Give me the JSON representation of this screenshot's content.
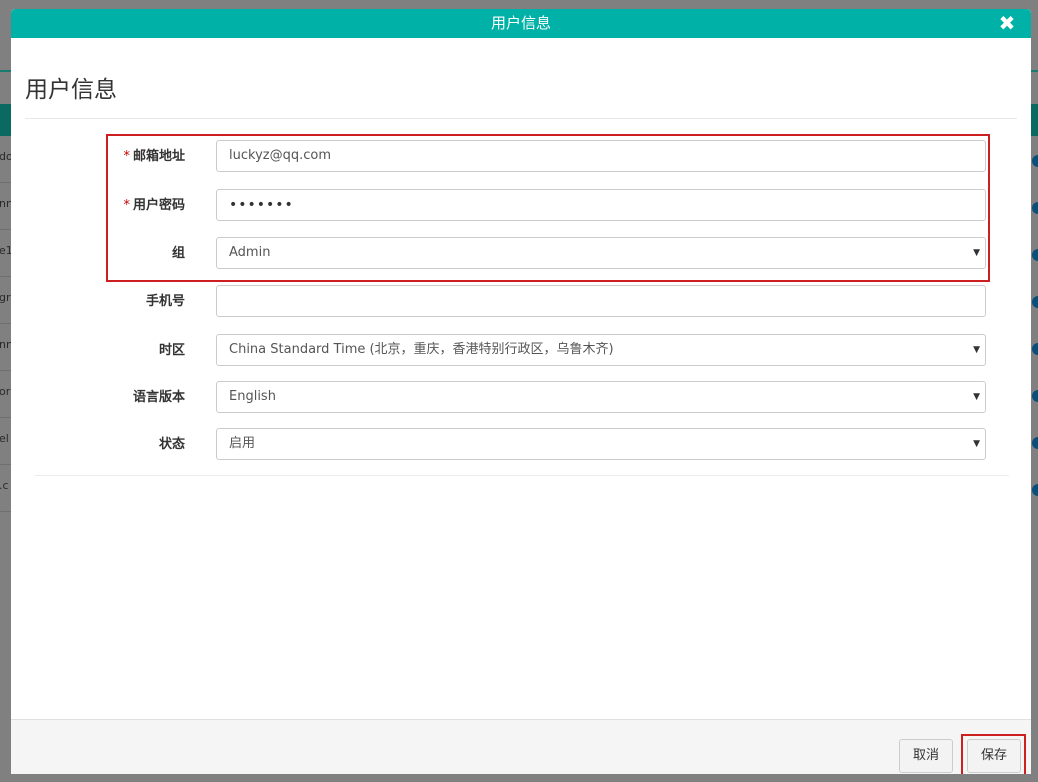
{
  "modal": {
    "title": "用户信息",
    "heading": "用户信息",
    "close_icon": "close-icon"
  },
  "background": {
    "fragments": [
      "do",
      "nn",
      "e1",
      "gr",
      "nn",
      "orp",
      "el",
      ".c"
    ]
  },
  "form": {
    "email": {
      "label": "邮箱地址",
      "required_mark": "*",
      "value": "luckyz@qq.com"
    },
    "password": {
      "label": "用户密码",
      "required_mark": "*",
      "value": "•••••••"
    },
    "group": {
      "label": "组",
      "value": "Admin"
    },
    "phone": {
      "label": "手机号",
      "value": ""
    },
    "timezone": {
      "label": "时区",
      "value": "China Standard Time (北京，重庆，香港特别行政区，乌鲁木齐)"
    },
    "language": {
      "label": "语言版本",
      "value": "English"
    },
    "status": {
      "label": "状态",
      "value": "启用"
    }
  },
  "footer": {
    "cancel_label": "取消",
    "save_label": "保存"
  },
  "colors": {
    "titlebar": "#00b1a7",
    "highlight": "#cc1f1f"
  }
}
